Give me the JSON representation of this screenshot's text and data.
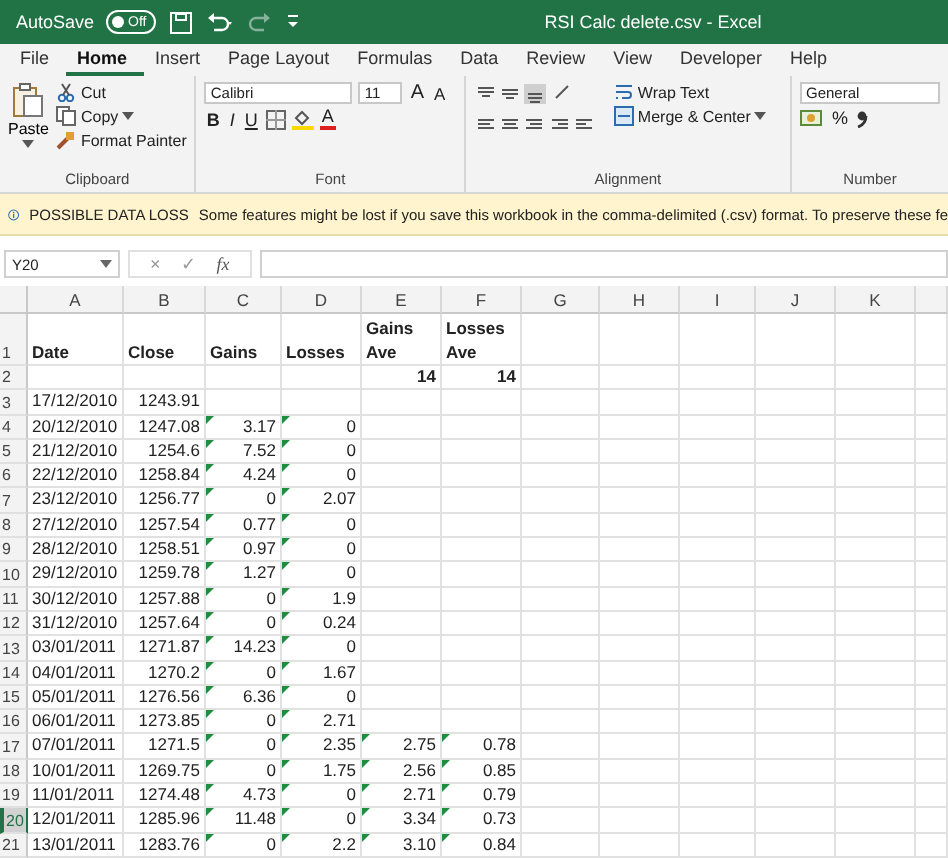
{
  "title_bar": {
    "autosave_label": "AutoSave",
    "autosave_toggle": {
      "label": "Off",
      "on": false
    },
    "title": "RSI Calc delete.csv  -  Excel"
  },
  "quick_access": [
    {
      "kind": "save",
      "disabled": false
    },
    {
      "kind": "undo",
      "disabled": false
    },
    {
      "kind": "redo",
      "disabled": true
    },
    {
      "kind": "customize",
      "disabled": false
    }
  ],
  "tabs": [
    {
      "label": "File",
      "selected": false
    },
    {
      "label": "Home",
      "selected": true
    },
    {
      "label": "Insert",
      "selected": false
    },
    {
      "label": "Page Layout",
      "selected": false
    },
    {
      "label": "Formulas",
      "selected": false
    },
    {
      "label": "Data",
      "selected": false
    },
    {
      "label": "Review",
      "selected": false
    },
    {
      "label": "View",
      "selected": false
    },
    {
      "label": "Developer",
      "selected": false
    },
    {
      "label": "Help",
      "selected": false
    }
  ],
  "ribbon": {
    "clipboard": {
      "label": "Clipboard",
      "paste": "Paste",
      "cut": "Cut",
      "copy": "Copy",
      "format_painter": "Format Painter"
    },
    "font": {
      "label": "Font",
      "font_name": "Calibri",
      "font_size": "11",
      "grow": "A",
      "shrink": "A",
      "bold": "B",
      "italic": "I",
      "underline": "U",
      "font_color": "A"
    },
    "alignment": {
      "label": "Alignment",
      "wrap_text": "Wrap Text",
      "merge_center": "Merge & Center"
    },
    "number": {
      "label": "Number",
      "format": "General",
      "percent": "%"
    }
  },
  "info_bar": {
    "title": "POSSIBLE DATA LOSS",
    "message": "Some features might be lost if you save this workbook in the comma-delimited (.csv) format. To preserve these fe"
  },
  "formula_bar": {
    "name_box": "Y20",
    "cancel": "×",
    "enter": "✓",
    "function": "fx"
  },
  "sheet": {
    "columns": [
      {
        "label": "A"
      },
      {
        "label": "B"
      },
      {
        "label": "C"
      },
      {
        "label": "D"
      },
      {
        "label": "E"
      },
      {
        "label": "F"
      },
      {
        "label": "G"
      },
      {
        "label": "H"
      },
      {
        "label": "I"
      },
      {
        "label": "J"
      },
      {
        "label": "K"
      }
    ],
    "rows": [
      {
        "header": "1",
        "selected": false,
        "bold": true,
        "cells": [
          {
            "text": "Date",
            "flagged": false
          },
          {
            "text": "Close",
            "flagged": false
          },
          {
            "text": "Gains",
            "flagged": false
          },
          {
            "text": "Losses",
            "flagged": false
          },
          {
            "text": "Gains Ave",
            "flagged": false
          },
          {
            "text": "Losses Ave",
            "flagged": false
          }
        ]
      },
      {
        "header": "2",
        "selected": false,
        "bold": true,
        "cells": [
          {
            "flagged": false
          },
          {
            "flagged": false
          },
          {
            "flagged": false
          },
          {
            "flagged": false
          },
          {
            "text": "14",
            "flagged": false
          },
          {
            "text": "14",
            "flagged": false
          }
        ]
      },
      {
        "header": "3",
        "selected": false,
        "bold": false,
        "cells": [
          {
            "text": "17/12/2010",
            "flagged": false
          },
          {
            "text": "1243.91",
            "flagged": false
          }
        ]
      },
      {
        "header": "4",
        "selected": false,
        "bold": false,
        "cells": [
          {
            "text": "20/12/2010",
            "flagged": false
          },
          {
            "text": "1247.08",
            "flagged": false
          },
          {
            "text": "3.17",
            "flagged": true
          },
          {
            "text": "0",
            "flagged": true
          }
        ]
      },
      {
        "header": "5",
        "selected": false,
        "bold": false,
        "cells": [
          {
            "text": "21/12/2010",
            "flagged": false
          },
          {
            "text": "1254.6",
            "flagged": false
          },
          {
            "text": "7.52",
            "flagged": true
          },
          {
            "text": "0",
            "flagged": true
          }
        ]
      },
      {
        "header": "6",
        "selected": false,
        "bold": false,
        "cells": [
          {
            "text": "22/12/2010",
            "flagged": false
          },
          {
            "text": "1258.84",
            "flagged": false
          },
          {
            "text": "4.24",
            "flagged": true
          },
          {
            "text": "0",
            "flagged": true
          }
        ]
      },
      {
        "header": "7",
        "selected": false,
        "bold": false,
        "cells": [
          {
            "text": "23/12/2010",
            "flagged": false
          },
          {
            "text": "1256.77",
            "flagged": false
          },
          {
            "text": "0",
            "flagged": true
          },
          {
            "text": "2.07",
            "flagged": true
          }
        ]
      },
      {
        "header": "8",
        "selected": false,
        "bold": false,
        "cells": [
          {
            "text": "27/12/2010",
            "flagged": false
          },
          {
            "text": "1257.54",
            "flagged": false
          },
          {
            "text": "0.77",
            "flagged": true
          },
          {
            "text": "0",
            "flagged": true
          }
        ]
      },
      {
        "header": "9",
        "selected": false,
        "bold": false,
        "cells": [
          {
            "text": "28/12/2010",
            "flagged": false
          },
          {
            "text": "1258.51",
            "flagged": false
          },
          {
            "text": "0.97",
            "flagged": true
          },
          {
            "text": "0",
            "flagged": true
          }
        ]
      },
      {
        "header": "10",
        "selected": false,
        "bold": false,
        "cells": [
          {
            "text": "29/12/2010",
            "flagged": false
          },
          {
            "text": "1259.78",
            "flagged": false
          },
          {
            "text": "1.27",
            "flagged": true
          },
          {
            "text": "0",
            "flagged": true
          }
        ]
      },
      {
        "header": "11",
        "selected": false,
        "bold": false,
        "cells": [
          {
            "text": "30/12/2010",
            "flagged": false
          },
          {
            "text": "1257.88",
            "flagged": false
          },
          {
            "text": "0",
            "flagged": true
          },
          {
            "text": "1.9",
            "flagged": true
          }
        ]
      },
      {
        "header": "12",
        "selected": false,
        "bold": false,
        "cells": [
          {
            "text": "31/12/2010",
            "flagged": false
          },
          {
            "text": "1257.64",
            "flagged": false
          },
          {
            "text": "0",
            "flagged": true
          },
          {
            "text": "0.24",
            "flagged": true
          }
        ]
      },
      {
        "header": "13",
        "selected": false,
        "bold": false,
        "cells": [
          {
            "text": "03/01/2011",
            "flagged": false
          },
          {
            "text": "1271.87",
            "flagged": false
          },
          {
            "text": "14.23",
            "flagged": true
          },
          {
            "text": "0",
            "flagged": true
          }
        ]
      },
      {
        "header": "14",
        "selected": false,
        "bold": false,
        "cells": [
          {
            "text": "04/01/2011",
            "flagged": false
          },
          {
            "text": "1270.2",
            "flagged": false
          },
          {
            "text": "0",
            "flagged": true
          },
          {
            "text": "1.67",
            "flagged": true
          }
        ]
      },
      {
        "header": "15",
        "selected": false,
        "bold": false,
        "cells": [
          {
            "text": "05/01/2011",
            "flagged": false
          },
          {
            "text": "1276.56",
            "flagged": false
          },
          {
            "text": "6.36",
            "flagged": true
          },
          {
            "text": "0",
            "flagged": true
          }
        ]
      },
      {
        "header": "16",
        "selected": false,
        "bold": false,
        "cells": [
          {
            "text": "06/01/2011",
            "flagged": false
          },
          {
            "text": "1273.85",
            "flagged": false
          },
          {
            "text": "0",
            "flagged": true
          },
          {
            "text": "2.71",
            "flagged": true
          }
        ]
      },
      {
        "header": "17",
        "selected": false,
        "bold": false,
        "cells": [
          {
            "text": "07/01/2011",
            "flagged": false
          },
          {
            "text": "1271.5",
            "flagged": false
          },
          {
            "text": "0",
            "flagged": true
          },
          {
            "text": "2.35",
            "flagged": true
          },
          {
            "text": "2.75",
            "flagged": true
          },
          {
            "text": "0.78",
            "flagged": true
          }
        ]
      },
      {
        "header": "18",
        "selected": false,
        "bold": false,
        "cells": [
          {
            "text": "10/01/2011",
            "flagged": false
          },
          {
            "text": "1269.75",
            "flagged": false
          },
          {
            "text": "0",
            "flagged": true
          },
          {
            "text": "1.75",
            "flagged": true
          },
          {
            "text": "2.56",
            "flagged": true
          },
          {
            "text": "0.85",
            "flagged": true
          }
        ]
      },
      {
        "header": "19",
        "selected": false,
        "bold": false,
        "cells": [
          {
            "text": "11/01/2011",
            "flagged": false
          },
          {
            "text": "1274.48",
            "flagged": false
          },
          {
            "text": "4.73",
            "flagged": true
          },
          {
            "text": "0",
            "flagged": true
          },
          {
            "text": "2.71",
            "flagged": true
          },
          {
            "text": "0.79",
            "flagged": true
          }
        ]
      },
      {
        "header": "20",
        "selected": true,
        "bold": false,
        "cells": [
          {
            "text": "12/01/2011",
            "flagged": false
          },
          {
            "text": "1285.96",
            "flagged": false
          },
          {
            "text": "11.48",
            "flagged": true
          },
          {
            "text": "0",
            "flagged": true
          },
          {
            "text": "3.34",
            "flagged": true
          },
          {
            "text": "0.73",
            "flagged": true
          }
        ]
      },
      {
        "header": "21",
        "selected": false,
        "bold": false,
        "cells": [
          {
            "text": "13/01/2011",
            "flagged": false
          },
          {
            "text": "1283.76",
            "flagged": false
          },
          {
            "text": "0",
            "flagged": true
          },
          {
            "text": "2.2",
            "flagged": true
          },
          {
            "text": "3.10",
            "flagged": true
          },
          {
            "text": "0.84",
            "flagged": true
          }
        ]
      }
    ]
  }
}
